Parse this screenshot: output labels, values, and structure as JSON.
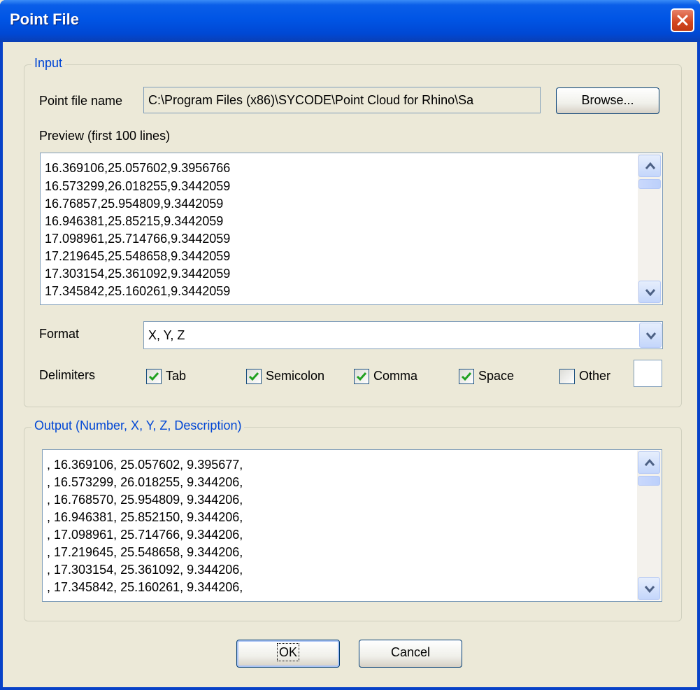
{
  "window": {
    "title": "Point File"
  },
  "input_group": {
    "legend": "Input",
    "point_file_label": "Point file name",
    "point_file_value": "C:\\Program Files (x86)\\SYCODE\\Point Cloud for Rhino\\Sa",
    "browse_label": "Browse...",
    "preview_label": "Preview (first 100 lines)",
    "preview_lines": [
      "16.369106,25.057602,9.3956766",
      "16.573299,26.018255,9.3442059",
      "16.76857,25.954809,9.3442059",
      "16.946381,25.85215,9.3442059",
      "17.098961,25.714766,9.3442059",
      "17.219645,25.548658,9.3442059",
      "17.303154,25.361092,9.3442059",
      "17.345842,25.160261,9.3442059"
    ],
    "format_label": "Format",
    "format_value": "X, Y, Z",
    "delimiters_label": "Delimiters",
    "delimiters": [
      {
        "label": "Tab",
        "checked": true
      },
      {
        "label": "Semicolon",
        "checked": true
      },
      {
        "label": "Comma",
        "checked": true
      },
      {
        "label": "Space",
        "checked": true
      },
      {
        "label": "Other",
        "checked": false
      }
    ],
    "other_value": ""
  },
  "output_group": {
    "legend": "Output (Number, X, Y, Z, Description)",
    "lines": [
      ", 16.369106, 25.057602, 9.395677,",
      ", 16.573299, 26.018255, 9.344206,",
      ", 16.768570, 25.954809, 9.344206,",
      ", 16.946381, 25.852150, 9.344206,",
      ", 17.098961, 25.714766, 9.344206,",
      ", 17.219645, 25.548658, 9.344206,",
      ", 17.303154, 25.361092, 9.344206,",
      ", 17.345842, 25.160261, 9.344206,"
    ]
  },
  "buttons": {
    "ok_label": "OK",
    "cancel_label": "Cancel"
  }
}
